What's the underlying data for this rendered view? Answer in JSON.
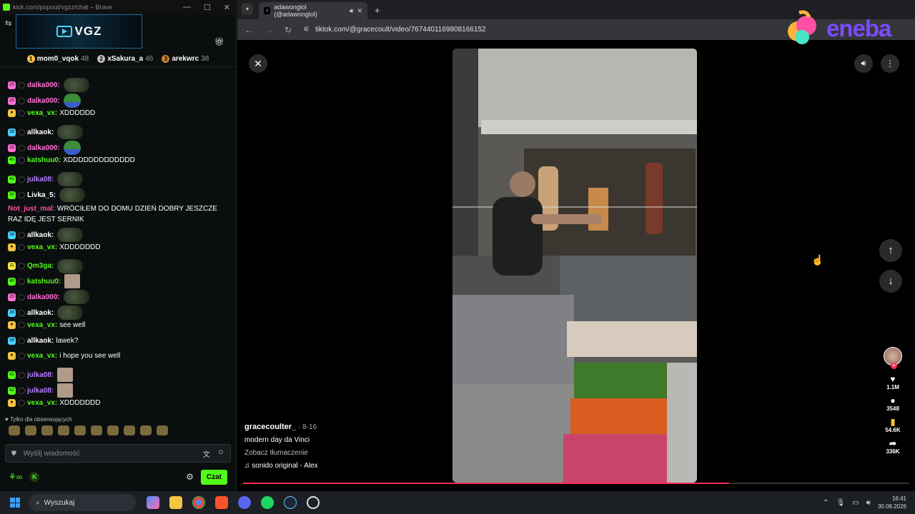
{
  "kick_window": {
    "title": "kick.com/popout/vgzz/chat – Brave",
    "channel_logo": "VGZ",
    "leaders": [
      {
        "rank": "1",
        "name": "mom0_vqok",
        "points": "48",
        "color": "#f5c542"
      },
      {
        "rank": "2",
        "name": "xSakura_a",
        "points": "46",
        "color": "#c0c0c0"
      },
      {
        "rank": "3",
        "name": "arekwrc",
        "points": "38",
        "color": "#cd7f32"
      }
    ]
  },
  "chat": {
    "messages": [
      {
        "badge": "25",
        "badge_color": "#ff6fd5",
        "user": "dalka000:",
        "user_color": "#ff6fd5",
        "text": "",
        "emote": "toad"
      },
      {
        "badge": "25",
        "badge_color": "#ff6fd5",
        "user": "dalka000:",
        "user_color": "#ff6fd5",
        "text": "",
        "emote": "frog"
      },
      {
        "badge": "★",
        "badge_color": "#f5c542",
        "user": "vexa_vx:",
        "user_color": "#53fc18",
        "text": "XDDDDDD",
        "emote": ""
      },
      {
        "badge": "38",
        "badge_color": "#4ad3ff",
        "user": "allkaok:",
        "user_color": "#ffffff",
        "text": "",
        "emote": "toad"
      },
      {
        "badge": "25",
        "badge_color": "#ff6fd5",
        "user": "dalka000:",
        "user_color": "#ff6fd5",
        "text": "",
        "emote": "frog"
      },
      {
        "badge": "40",
        "badge_color": "#53fc18",
        "user": "katshuu0:",
        "user_color": "#53fc18",
        "text": "XDDDDDDDDDDDDD",
        "emote": ""
      },
      {
        "badge": "42",
        "badge_color": "#53fc18",
        "user": "julka08:",
        "user_color": "#b57bff",
        "text": "",
        "emote": "toad"
      },
      {
        "badge": "30",
        "badge_color": "#53fc18",
        "user": "Livka_5:",
        "user_color": "#ffffff",
        "text": "",
        "emote": "toad"
      }
    ],
    "long_message": {
      "user": "Not_just_mal:",
      "user_color": "#ff4fa3",
      "text": "WRÓCIŁEM DO DOMU DZIEŃ DOBRY JESZCZE RAZ IDĘ JEST SERNIK"
    },
    "messages2": [
      {
        "badge": "38",
        "badge_color": "#4ad3ff",
        "user": "allkaok:",
        "user_color": "#ffffff",
        "text": "",
        "emote": "toad"
      },
      {
        "badge": "★",
        "badge_color": "#f5c542",
        "user": "vexa_vx:",
        "user_color": "#53fc18",
        "text": "XDDDDDDD",
        "emote": ""
      },
      {
        "badge": "11",
        "badge_color": "#f5e642",
        "user": "Qm3ga:",
        "user_color": "#53fc18",
        "text": "",
        "emote": "toad"
      },
      {
        "badge": "40",
        "badge_color": "#53fc18",
        "user": "katshuu0:",
        "user_color": "#53fc18",
        "text": "",
        "emote": "face"
      },
      {
        "badge": "25",
        "badge_color": "#ff6fd5",
        "user": "dalka000:",
        "user_color": "#ff6fd5",
        "text": "",
        "emote": "toad"
      },
      {
        "badge": "38",
        "badge_color": "#4ad3ff",
        "user": "allkaok:",
        "user_color": "#ffffff",
        "text": "",
        "emote": "toad"
      },
      {
        "badge": "★",
        "badge_color": "#f5c542",
        "user": "vexa_vx:",
        "user_color": "#53fc18",
        "text": "see well",
        "emote": ""
      },
      {
        "badge": "38",
        "badge_color": "#4ad3ff",
        "user": "allkaok:",
        "user_color": "#ffffff",
        "text": "lawek?",
        "emote": ""
      },
      {
        "badge": "★",
        "badge_color": "#f5c542",
        "user": "vexa_vx:",
        "user_color": "#53fc18",
        "text": "i hope you see well",
        "emote": ""
      },
      {
        "badge": "42",
        "badge_color": "#53fc18",
        "user": "julka08:",
        "user_color": "#b57bff",
        "text": "",
        "emote": "face"
      },
      {
        "badge": "42",
        "badge_color": "#53fc18",
        "user": "julka08:",
        "user_color": "#b57bff",
        "text": "",
        "emote": "face"
      },
      {
        "badge": "★",
        "badge_color": "#f5c542",
        "user": "vexa_vx:",
        "user_color": "#53fc18",
        "text": "XDDDDDDD",
        "emote": ""
      }
    ],
    "followers_only": "Tylko dla obserwujących",
    "input_placeholder": "Wyślij wiadomość",
    "send_label": "Czat"
  },
  "browser": {
    "tab_title": "adawonglol (@adawonglol)",
    "url": "tiktok.com/@gracecoult/video/7674401169808166152"
  },
  "video": {
    "username": "gracecoulter_",
    "date": "· 8-16",
    "description": "modern day da Vinci",
    "translate": "Zobacz tłumaczenie",
    "sound": "sonido original - Alex",
    "likes": "1.1M",
    "comments": "3548",
    "saves": "54.6K",
    "shares": "336K",
    "progress": 0.73
  },
  "brand": {
    "eneba": "eneba"
  },
  "taskbar": {
    "search": "Wyszukaj",
    "time": "16:41",
    "date": "30.08.2026"
  }
}
